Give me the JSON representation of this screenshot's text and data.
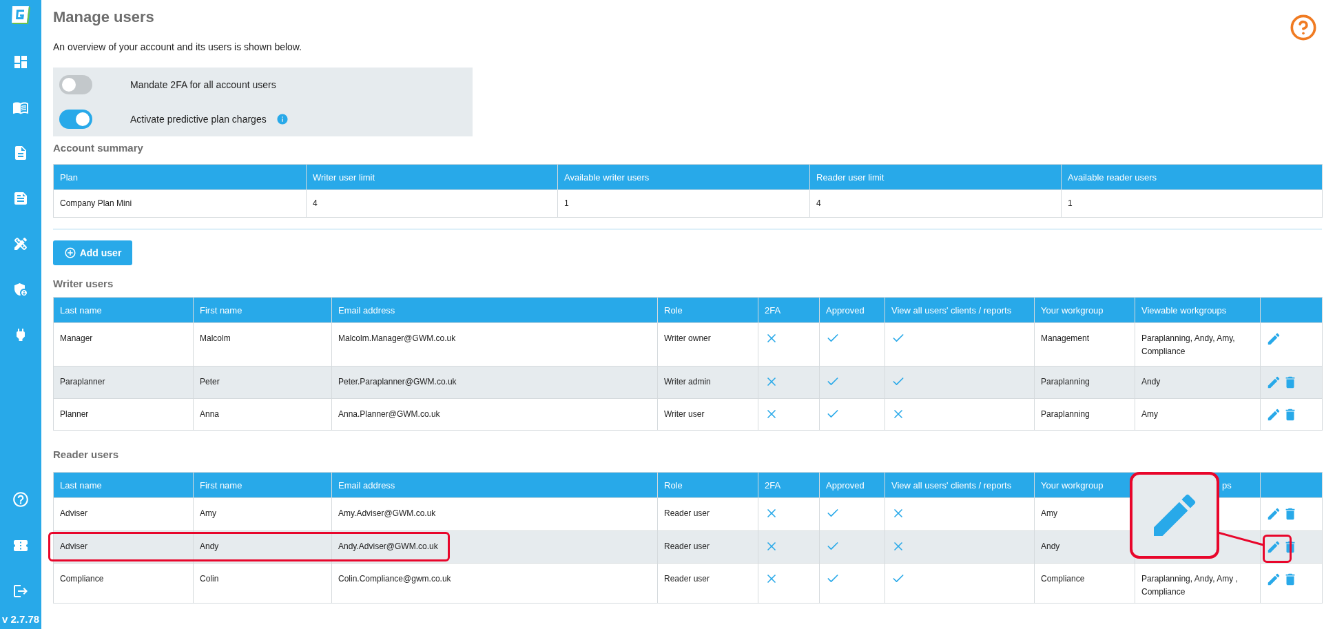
{
  "sidebar": {
    "version": "v 2.7.78"
  },
  "page": {
    "title": "Manage users",
    "subtitle": "An overview of your account and its users is shown below."
  },
  "settings": [
    {
      "label": "Mandate 2FA for all account users",
      "on": false,
      "info": false
    },
    {
      "label": "Activate predictive plan charges",
      "on": true,
      "info": true
    }
  ],
  "account_summary": {
    "heading": "Account summary",
    "columns": [
      "Plan",
      "Writer user limit",
      "Available writer users",
      "Reader user limit",
      "Available reader users"
    ],
    "row": [
      "Company Plan Mini",
      "4",
      "1",
      "4",
      "1"
    ]
  },
  "add_user_button": "Add user",
  "writer_users": {
    "heading": "Writer users",
    "columns": [
      {
        "label": "Last name",
        "clipped": false
      },
      {
        "label": "First name",
        "clipped": false
      },
      {
        "label": "Email address",
        "clipped": false
      },
      {
        "label": "Role",
        "clipped": false
      },
      {
        "label": "2FA",
        "clipped": false
      },
      {
        "label": "Approved",
        "clipped": false
      },
      {
        "label": "View all users' clients / reports",
        "clipped": false
      },
      {
        "label": "Your workgroup",
        "clipped": false
      },
      {
        "label": "Viewable workgroups",
        "clipped": false
      }
    ],
    "rows": [
      {
        "last_name": "Manager",
        "first_name": "Malcolm",
        "email": "Malcolm.Manager@GWM.co.uk",
        "role": "Writer owner",
        "two_fa": false,
        "approved": true,
        "view_all": true,
        "workgroup": "Management",
        "viewable": "Paraplanning, Andy, Amy, Compliance",
        "deletable": false,
        "highlighted": false,
        "callout": false
      },
      {
        "last_name": "Paraplanner",
        "first_name": "Peter",
        "email": "Peter.Paraplanner@GWM.co.uk",
        "role": "Writer admin",
        "two_fa": false,
        "approved": true,
        "view_all": true,
        "workgroup": "Paraplanning",
        "viewable": "Andy",
        "deletable": true,
        "highlighted": false,
        "callout": false
      },
      {
        "last_name": "Planner",
        "first_name": "Anna",
        "email": "Anna.Planner@GWM.co.uk",
        "role": "Writer user",
        "two_fa": false,
        "approved": true,
        "view_all": false,
        "workgroup": "Paraplanning",
        "viewable": "Amy",
        "deletable": true,
        "highlighted": false,
        "callout": false
      }
    ]
  },
  "reader_users": {
    "heading": "Reader users",
    "columns": [
      {
        "label": "Last name",
        "clipped": false
      },
      {
        "label": "First name",
        "clipped": false
      },
      {
        "label": "Email address",
        "clipped": false
      },
      {
        "label": "Role",
        "clipped": false
      },
      {
        "label": "2FA",
        "clipped": false
      },
      {
        "label": "Approved",
        "clipped": false
      },
      {
        "label": "View all users' clients / reports",
        "clipped": false
      },
      {
        "label": "Your workgroup",
        "clipped": false
      },
      {
        "label": "ps",
        "clipped": true
      }
    ],
    "rows": [
      {
        "last_name": "Adviser",
        "first_name": "Amy",
        "email": "Amy.Adviser@GWM.co.uk",
        "role": "Reader user",
        "two_fa": false,
        "approved": true,
        "view_all": false,
        "workgroup": "Amy",
        "deletable": true,
        "highlighted": false,
        "callout": false
      },
      {
        "last_name": "Adviser",
        "first_name": "Andy",
        "email": "Andy.Adviser@GWM.co.uk",
        "role": "Reader user",
        "two_fa": false,
        "approved": true,
        "view_all": false,
        "workgroup": "Andy",
        "deletable": true,
        "highlighted": true,
        "callout": true
      },
      {
        "last_name": "Compliance",
        "first_name": "Colin",
        "email": "Colin.Compliance@gwm.co.uk",
        "role": "Reader user",
        "two_fa": false,
        "approved": true,
        "view_all": true,
        "workgroup": "Compliance",
        "viewable": "Paraplanning, Andy, Amy , Compliance",
        "deletable": true,
        "highlighted": false,
        "callout": false
      }
    ]
  }
}
